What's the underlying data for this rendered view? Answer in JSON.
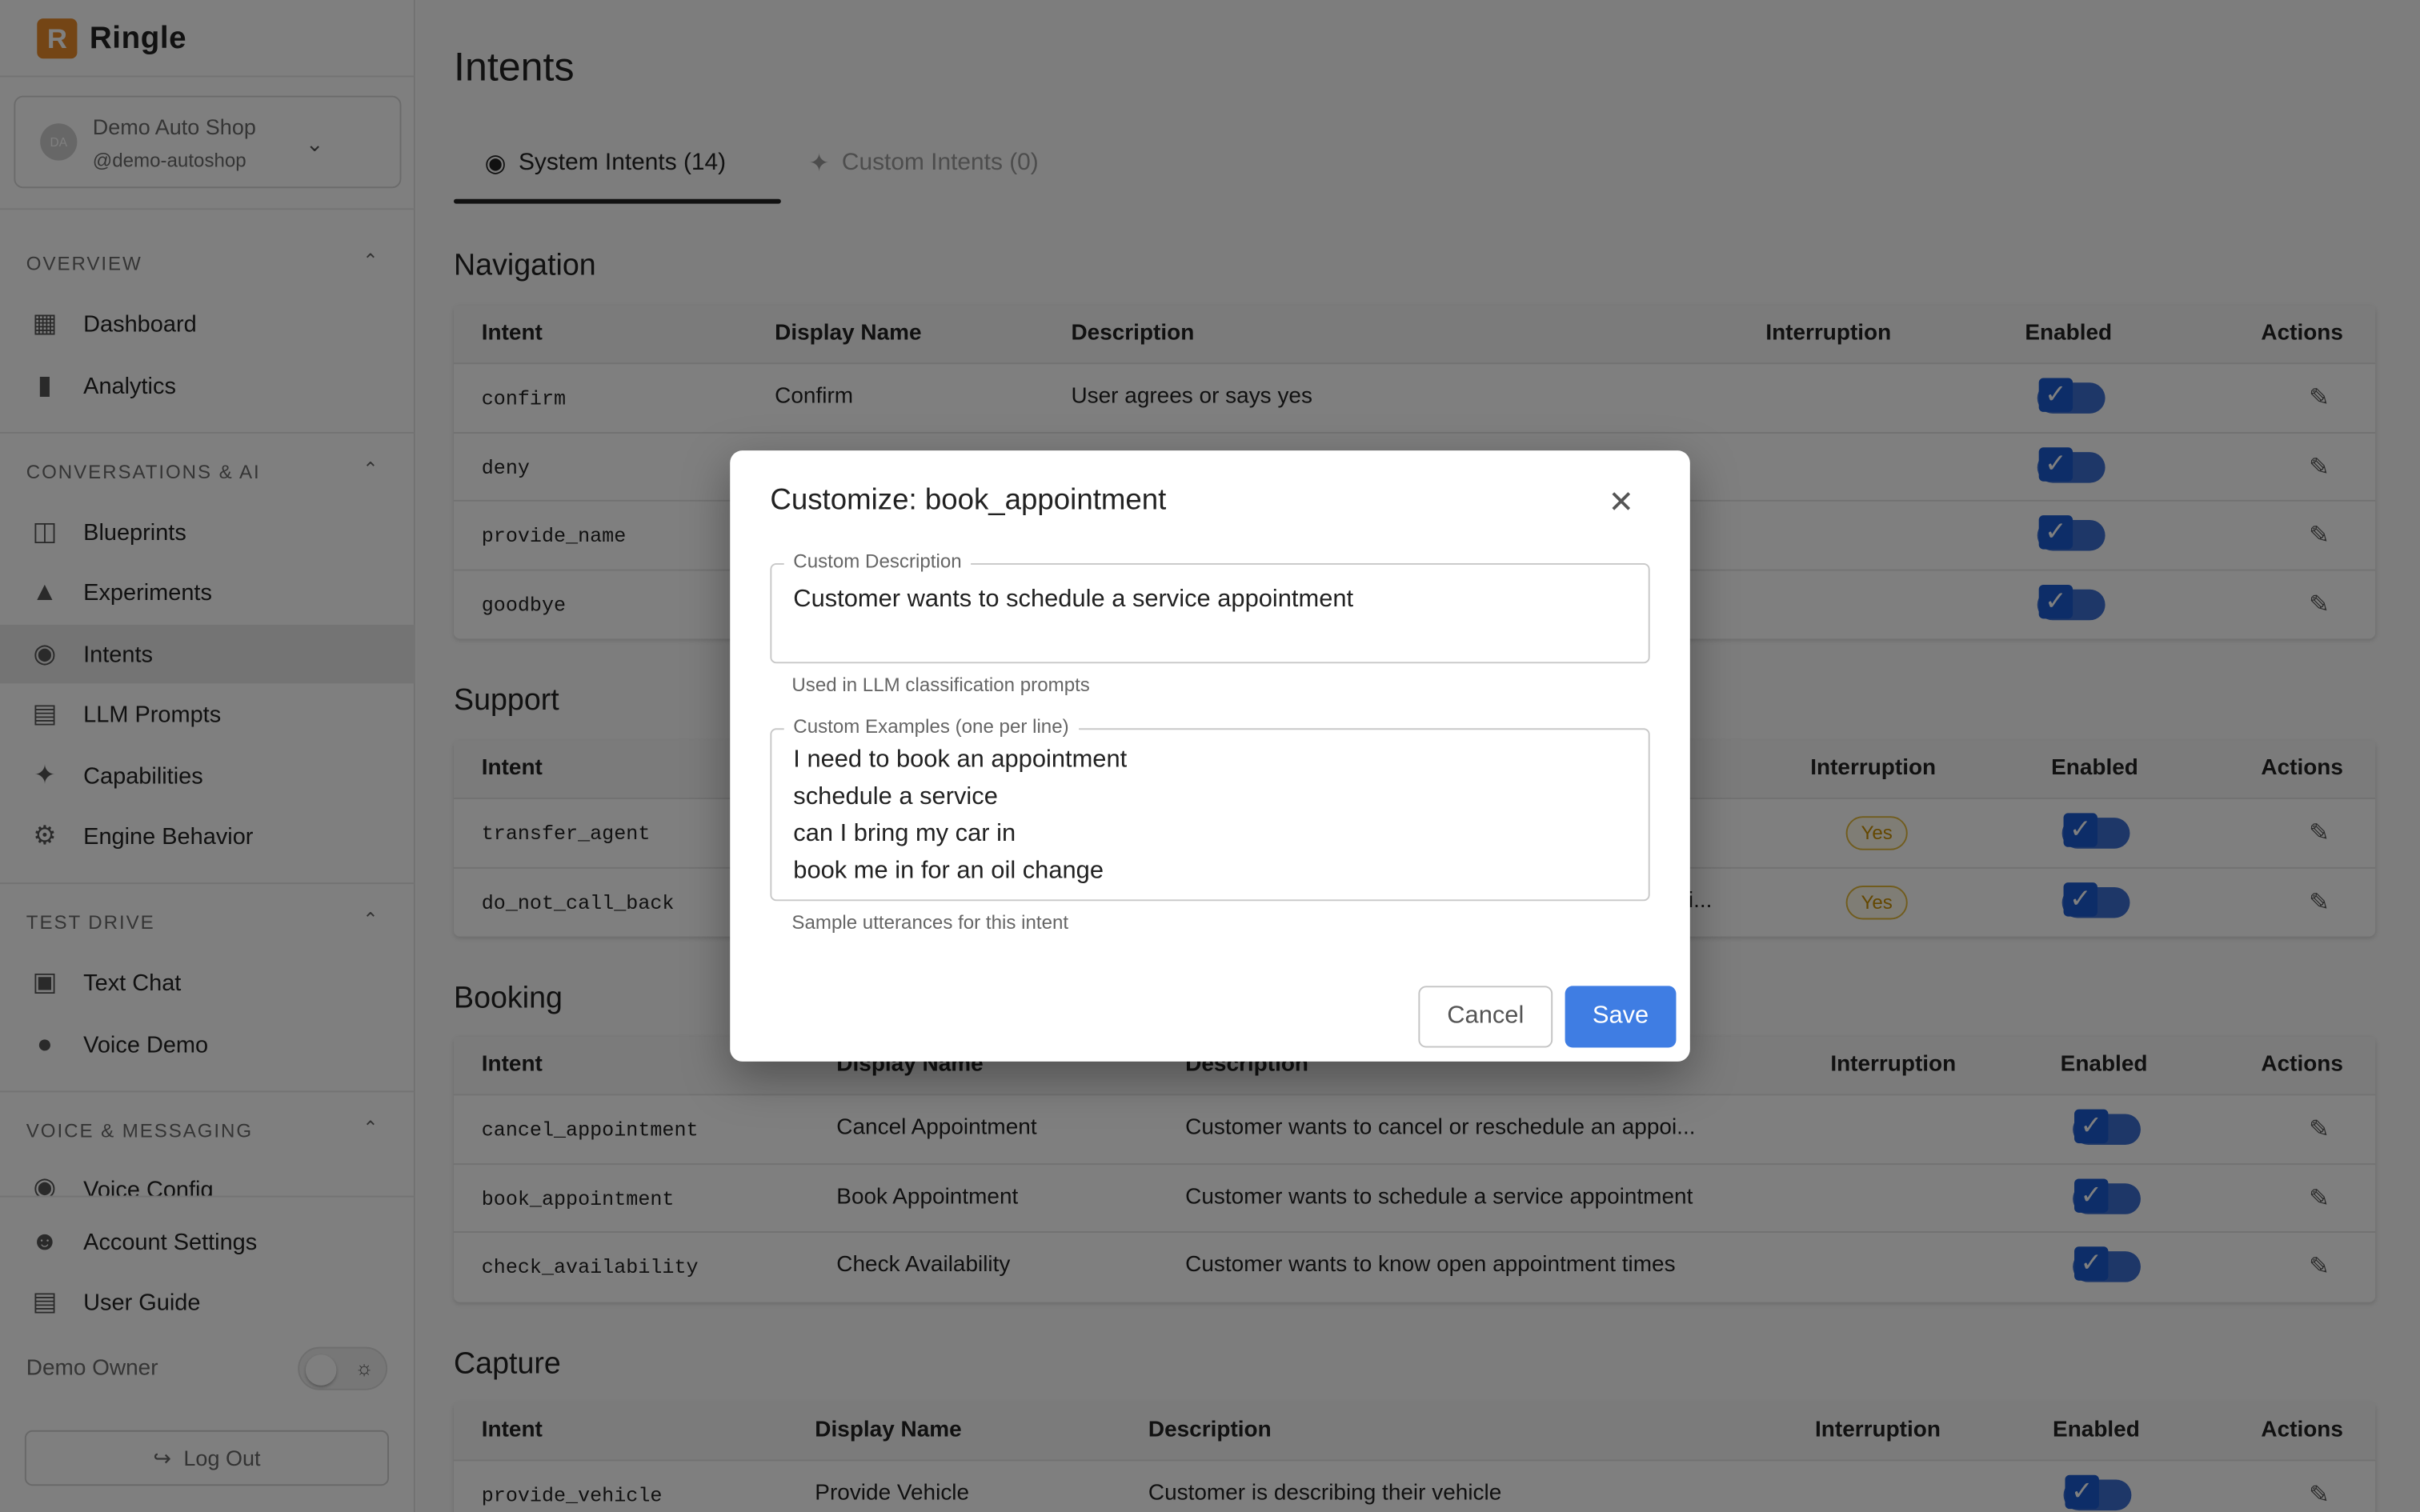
{
  "brand": {
    "logo_letter": "R",
    "name": "Ringle"
  },
  "account": {
    "initials": "DA",
    "name": "Demo Auto Shop",
    "handle": "@demo-autoshop"
  },
  "sidebar": {
    "sections": [
      {
        "title": "OVERVIEW",
        "items": [
          {
            "label": "Dashboard",
            "icon": "dashboard-icon"
          },
          {
            "label": "Analytics",
            "icon": "bar-chart-icon"
          }
        ]
      },
      {
        "title": "CONVERSATIONS & AI",
        "items": [
          {
            "label": "Blueprints",
            "icon": "blueprints-icon"
          },
          {
            "label": "Experiments",
            "icon": "flask-icon"
          },
          {
            "label": "Intents",
            "icon": "brain-icon"
          },
          {
            "label": "LLM Prompts",
            "icon": "document-icon"
          },
          {
            "label": "Capabilities",
            "icon": "puzzle-icon"
          },
          {
            "label": "Engine Behavior",
            "icon": "gear-icon"
          }
        ]
      },
      {
        "title": "TEST DRIVE",
        "items": [
          {
            "label": "Text Chat",
            "icon": "chat-icon"
          },
          {
            "label": "Voice Demo",
            "icon": "mic-icon"
          }
        ]
      },
      {
        "title": "VOICE & MESSAGING",
        "items": [
          {
            "label": "Voice Config",
            "icon": "voice-icon"
          }
        ]
      }
    ],
    "bottom": {
      "account_settings": "Account Settings",
      "user_guide": "User Guide",
      "user_name": "Demo Owner",
      "logout": "Log Out"
    }
  },
  "main": {
    "title": "Intents",
    "tabs": [
      {
        "label": "System Intents (14)",
        "active": true
      },
      {
        "label": "Custom Intents (0)",
        "active": false
      }
    ],
    "columns": [
      "Intent",
      "Display Name",
      "Description",
      "Interruption",
      "Enabled",
      "Actions"
    ],
    "sections": {
      "navigation": {
        "title": "Navigation",
        "rows": [
          {
            "intent": "confirm",
            "display": "Confirm",
            "description": "User agrees or says yes"
          },
          {
            "intent": "deny",
            "display": "",
            "description": ""
          },
          {
            "intent": "provide_name",
            "display": "",
            "description": ""
          },
          {
            "intent": "goodbye",
            "display": "",
            "description": ""
          }
        ]
      },
      "support": {
        "title": "Support",
        "rows": [
          {
            "intent": "transfer_agent",
            "description": "",
            "interruption": "Yes"
          },
          {
            "intent": "do_not_call_back",
            "description": "i...",
            "interruption": "Yes"
          }
        ]
      },
      "booking": {
        "title": "Booking",
        "rows": [
          {
            "intent": "cancel_appointment",
            "display": "Cancel Appointment",
            "description": "Customer wants to cancel or reschedule an appoi..."
          },
          {
            "intent": "book_appointment",
            "display": "Book Appointment",
            "description": "Customer wants to schedule a service appointment"
          },
          {
            "intent": "check_availability",
            "display": "Check Availability",
            "description": "Customer wants to know open appointment times"
          }
        ]
      },
      "capture": {
        "title": "Capture",
        "rows": [
          {
            "intent": "provide_vehicle",
            "display": "Provide Vehicle",
            "description": "Customer is describing their vehicle"
          }
        ]
      }
    }
  },
  "dialog": {
    "title": "Customize: book_appointment",
    "description_label": "Custom Description",
    "description_value": "Customer wants to schedule a service appointment",
    "description_helper": "Used in LLM classification prompts",
    "examples_label": "Custom Examples (one per line)",
    "examples_value": "I need to book an appointment\nschedule a service\ncan I bring my car in\nbook me in for an oil change",
    "examples_helper": "Sample utterances for this intent",
    "cancel": "Cancel",
    "save": "Save"
  },
  "colors": {
    "accent": "#3f7de3",
    "toggle": "#1b5bd0",
    "badge": "#e2b93b",
    "brand": "#e98a2a"
  }
}
